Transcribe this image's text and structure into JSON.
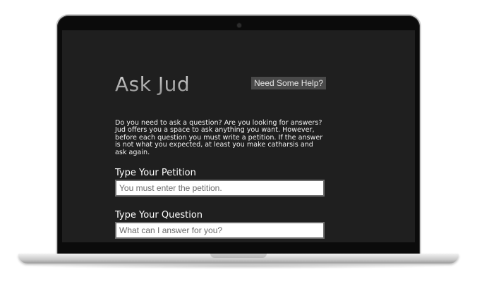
{
  "app": {
    "title": "Ask Jud",
    "help_button_label": "Need Some Help?",
    "intro_text": "Do you need to ask a question? Are you looking for answers? Jud offers you a space to ask anything you want. However, before each question you must write a petition. If the answer is not what you expected, at least you make catharsis and ask again."
  },
  "form": {
    "petition": {
      "label": "Type Your Petition",
      "value": "",
      "placeholder": "You must enter the petition."
    },
    "question": {
      "label": "Type Your Question",
      "value": "",
      "placeholder": "What can I answer for you?"
    }
  },
  "icons": {
    "device": "laptop-frame-icon",
    "camera": "webcam-icon"
  },
  "colors": {
    "screen_background": "#1f1f1f",
    "help_button_background": "#4a4a4a",
    "text": "#f0f0f0",
    "input_border": "#6e6e6e"
  }
}
